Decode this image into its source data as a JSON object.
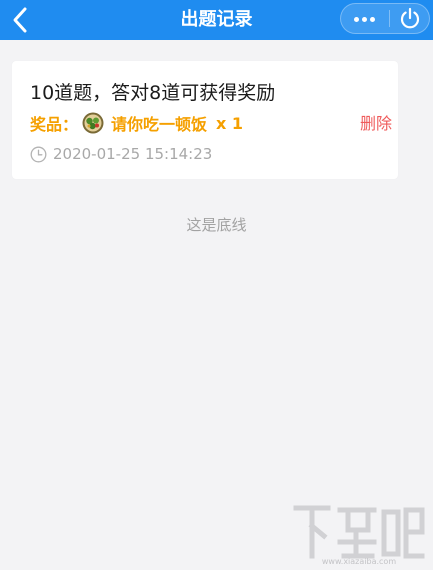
{
  "header": {
    "title": "出题记录",
    "back_icon": "chevron-left-icon",
    "more_icon": "more-dots-icon",
    "power_icon": "power-icon",
    "bg_color": "#1f8cf0"
  },
  "record": {
    "title": "10道题，答对8道可获得奖励",
    "prize_label": "奖品：",
    "prize_name": "请你吃一顿饭",
    "prize_count": "x 1",
    "prize_image_icon": "food-bowl-icon",
    "delete_label": "删除",
    "time": "2020-01-25 15:14:23",
    "time_icon": "clock-icon",
    "accent_color": "#f5a000",
    "delete_color": "#ef5a5a"
  },
  "footer": {
    "text": "这是底线"
  },
  "watermark": {
    "text": "下载吧",
    "url": "www.xiazaiba.com"
  }
}
